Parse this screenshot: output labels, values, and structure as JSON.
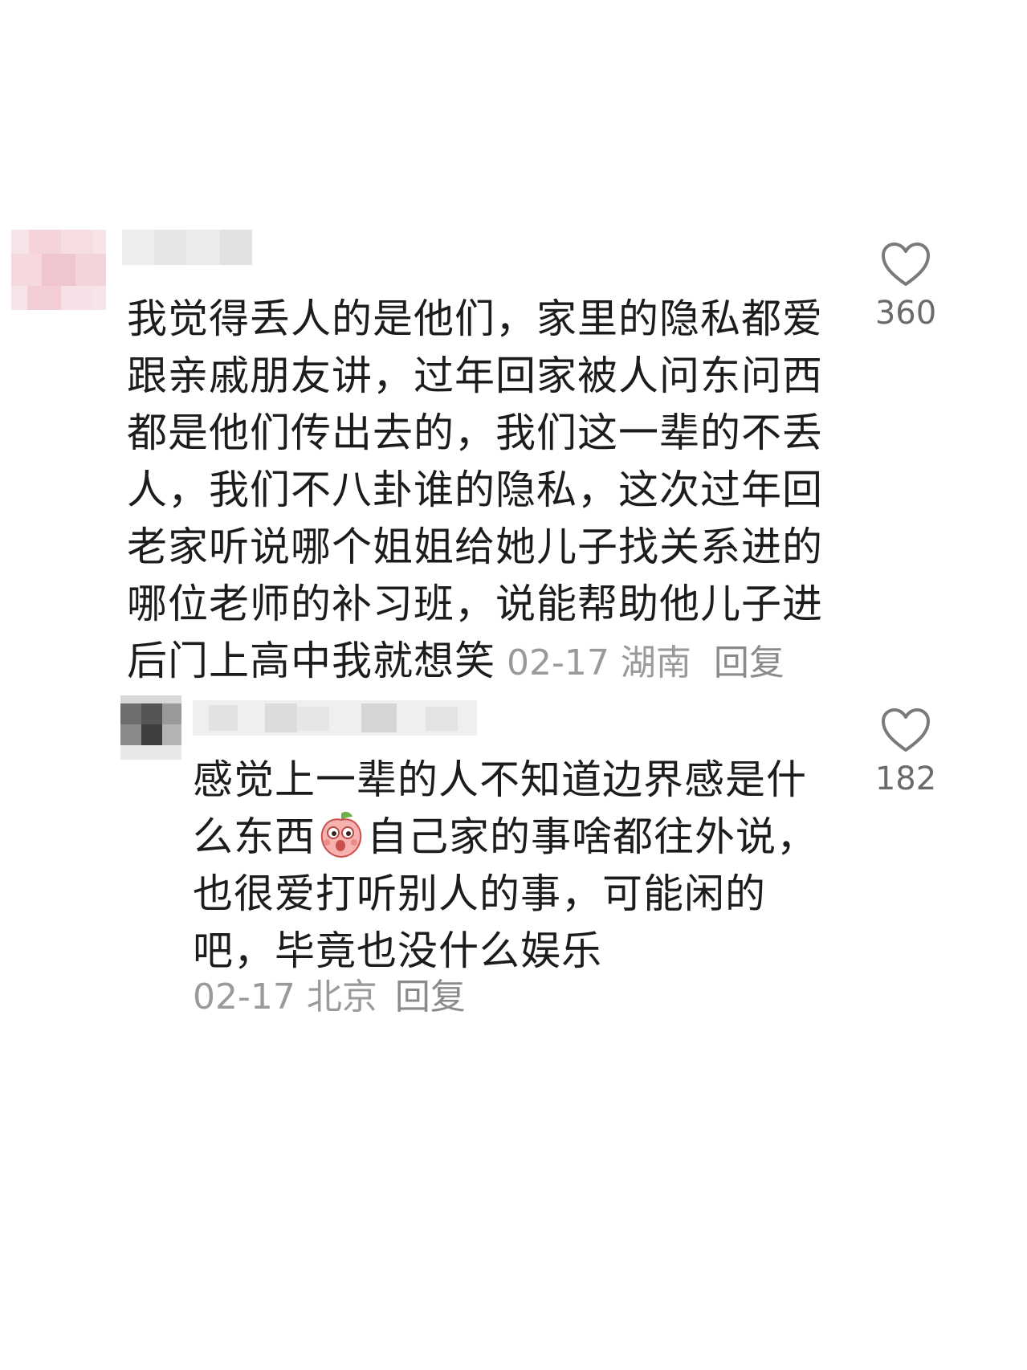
{
  "comments": [
    {
      "text": "我觉得丢人的是他们，家里的隐私都爱跟亲戚朋友讲，过年回家被人问东问西都是他们传出去的，我们这一辈的不丢人，我们不八卦谁的隐私，这次过年回老家听说哪个姐姐给她儿子找关系进的哪位老师的补习班，说能帮助他儿子进后门上高中我就想笑",
      "date": "02-17",
      "location": "湖南",
      "reply_label": "回复",
      "likes": "360"
    },
    {
      "text_before_emoji": "感觉上一辈的人不知道边界感是什么东西",
      "emoji": "peach-emoji",
      "text_after_emoji": "自己家的事啥都往外说，也很爱打听别人的事，可能闲的吧，毕竟也没什么娱乐",
      "date": "02-17",
      "location": "北京",
      "reply_label": "回复",
      "likes": "182"
    }
  ],
  "colors": {
    "text": "#1c1c1c",
    "meta": "#9a9a9a",
    "like_icon": "#7a7a7a"
  }
}
